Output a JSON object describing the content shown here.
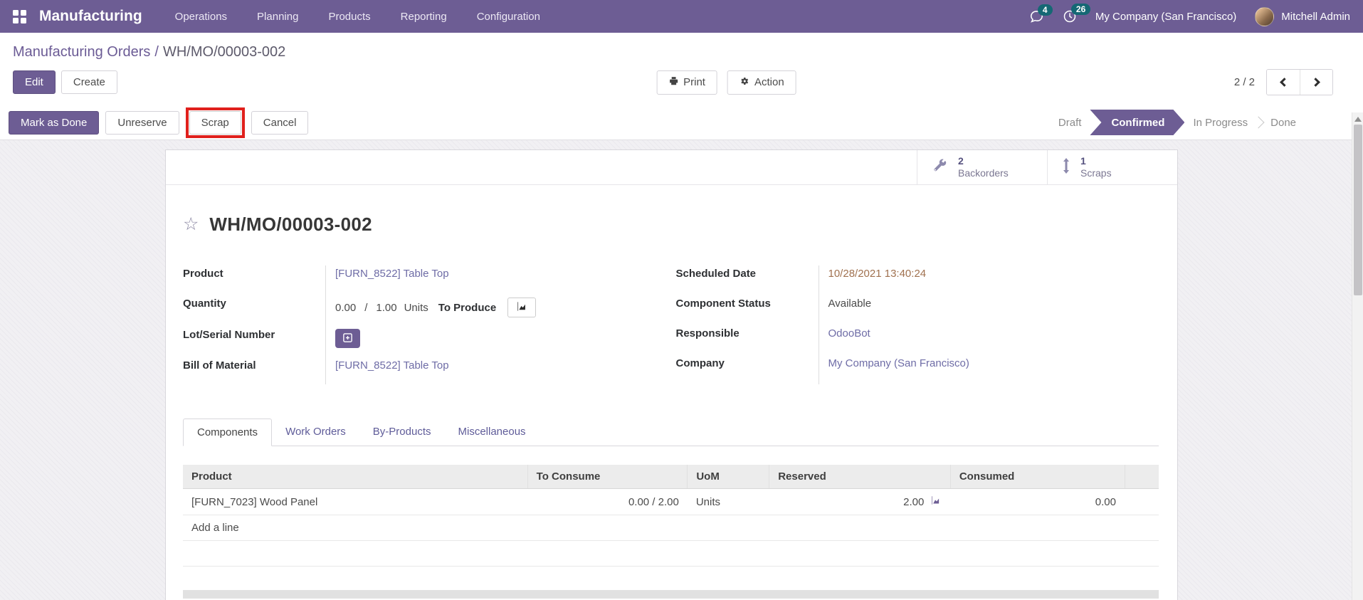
{
  "colors": {
    "accent": "#6d5d94",
    "badge_teal": "#156874",
    "highlight_red": "#e0201c",
    "link": "#6e6ca6",
    "date_brown": "#a0714f"
  },
  "navbar": {
    "app_name": "Manufacturing",
    "menus": [
      "Operations",
      "Planning",
      "Products",
      "Reporting",
      "Configuration"
    ],
    "messages_badge": "4",
    "activities_badge": "26",
    "company": "My Company (San Francisco)",
    "user": "Mitchell Admin"
  },
  "breadcrumb": {
    "parent": "Manufacturing Orders",
    "separator": "/",
    "current": "WH/MO/00003-002"
  },
  "control_panel": {
    "edit_label": "Edit",
    "create_label": "Create",
    "print_label": "Print",
    "action_label": "Action",
    "pager": "2 / 2"
  },
  "statusbar": {
    "buttons": [
      {
        "label": "Mark as Done"
      },
      {
        "label": "Unreserve"
      },
      {
        "label": "Scrap"
      },
      {
        "label": "Cancel"
      }
    ],
    "steps": [
      {
        "label": "Draft"
      },
      {
        "label": "Confirmed"
      },
      {
        "label": "In Progress"
      },
      {
        "label": "Done"
      }
    ]
  },
  "form": {
    "button_box": [
      {
        "icon": "wrench-icon",
        "count": "2",
        "label": "Backorders"
      },
      {
        "icon": "arrows-v-icon",
        "count": "1",
        "label": "Scraps"
      }
    ],
    "title": "WH/MO/00003-002",
    "fields": {
      "product": {
        "label": "Product",
        "value": "[FURN_8522] Table Top"
      },
      "quantity": {
        "label": "Quantity",
        "done": "0.00",
        "sep": "/",
        "total": "1.00",
        "uom": "Units",
        "suffix": "To Produce"
      },
      "lot": {
        "label": "Lot/Serial Number"
      },
      "bom": {
        "label": "Bill of Material",
        "value": "[FURN_8522] Table Top"
      },
      "scheduled_date": {
        "label": "Scheduled Date",
        "value": "10/28/2021 13:40:24"
      },
      "component_status": {
        "label": "Component Status",
        "value": "Available"
      },
      "responsible": {
        "label": "Responsible",
        "value": "OdooBot"
      },
      "company": {
        "label": "Company",
        "value": "My Company (San Francisco)"
      }
    },
    "tabs": [
      {
        "label": "Components"
      },
      {
        "label": "Work Orders"
      },
      {
        "label": "By-Products"
      },
      {
        "label": "Miscellaneous"
      }
    ]
  },
  "components_table": {
    "columns": [
      "Product",
      "To Consume",
      "UoM",
      "Reserved",
      "Consumed"
    ],
    "rows": [
      {
        "product": "[FURN_7023] Wood Panel",
        "to_consume": "0.00 / 2.00",
        "uom": "Units",
        "reserved": "2.00",
        "consumed": "0.00"
      }
    ],
    "add_line_label": "Add a line"
  }
}
